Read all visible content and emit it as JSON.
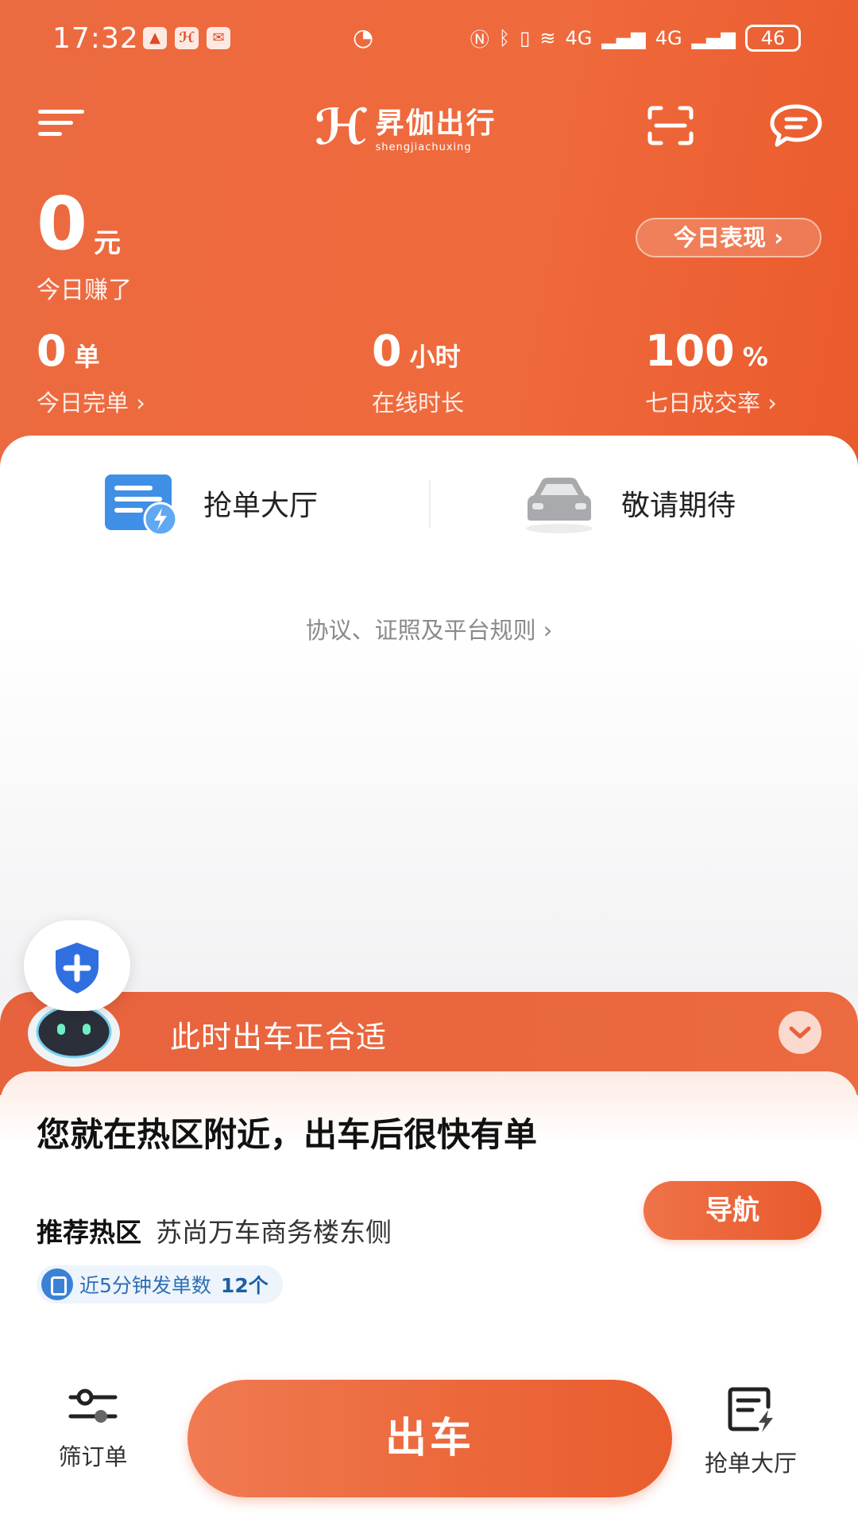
{
  "status_bar": {
    "time": "17:32",
    "battery": "46",
    "network_labels": [
      "4G",
      "4G"
    ],
    "notif_icons": [
      "app-icon",
      "shengjia-icon",
      "mail-icon"
    ]
  },
  "top_bar": {
    "logo_mark": "ℋ",
    "logo_cn": "昇伽出行",
    "logo_en": "shengjiachuxing"
  },
  "earnings": {
    "amount": "0",
    "unit": "元",
    "label": "今日赚了",
    "performance_btn": "今日表现 ›"
  },
  "stats": [
    {
      "value": "0",
      "unit": "单",
      "label": "今日完单 ›"
    },
    {
      "value": "0",
      "unit": "小时",
      "label": "在线时长"
    },
    {
      "value": "100",
      "unit": "%",
      "label": "七日成交率 ›"
    }
  ],
  "entries": [
    {
      "label": "抢单大厅",
      "icon": "order-hall-icon"
    },
    {
      "label": "敬请期待",
      "icon": "car-icon"
    }
  ],
  "rules_link": "协议、证照及平台规则 ›",
  "banner": {
    "title": "此时出车正合适"
  },
  "hotspot": {
    "title": "您就在热区附近，出车后很快有单",
    "sub_label": "推荐热区",
    "sub_value": "苏尚万车商务楼东侧",
    "badge_text": "近5分钟发单数",
    "badge_count": "12个",
    "nav_button": "导航"
  },
  "bottom": {
    "filter_label": "筛订单",
    "go_button": "出车",
    "hall_label": "抢单大厅"
  },
  "colors": {
    "brand": "#EC6A3F",
    "accent_blue": "#3B82D6"
  }
}
